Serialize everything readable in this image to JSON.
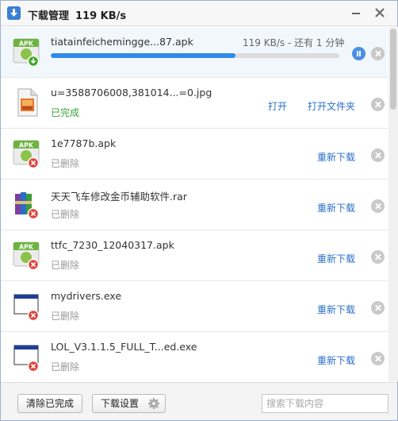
{
  "window": {
    "title": "下载管理",
    "speed": "119 KB/s"
  },
  "downloads": [
    {
      "name": "tiatainfeichemingge...87.apk",
      "speed_eta": "119 KB/s - 还有 1 分钟",
      "progress": 0.64,
      "type": "apk",
      "state": "downloading"
    },
    {
      "name": "u=3588706008,381014...=0.jpg",
      "status": "已完成",
      "type": "image",
      "state": "done",
      "action_open": "打开",
      "action_folder": "打开文件夹"
    },
    {
      "name": "1e7787b.apk",
      "status": "已删除",
      "type": "apk",
      "state": "deleted",
      "action": "重新下载"
    },
    {
      "name": "天天飞车修改金币辅助软件.rar",
      "status": "已删除",
      "type": "rar",
      "state": "deleted",
      "action": "重新下载"
    },
    {
      "name": "ttfc_7230_12040317.apk",
      "status": "已删除",
      "type": "apk",
      "state": "deleted",
      "action": "重新下载"
    },
    {
      "name": "mydrivers.exe",
      "status": "已删除",
      "type": "exe",
      "state": "deleted",
      "action": "重新下载"
    },
    {
      "name": "LOL_V3.1.1.5_FULL_T...ed.exe",
      "status": "已删除",
      "type": "exe",
      "state": "deleted",
      "action": "重新下载"
    }
  ],
  "footer": {
    "clear_label": "清除已完成",
    "settings_label": "下载设置",
    "search_placeholder": "搜索下载内容"
  },
  "colors": {
    "accent": "#2f8ae8",
    "link": "#2a6fc9",
    "done": "#3aa53a"
  }
}
